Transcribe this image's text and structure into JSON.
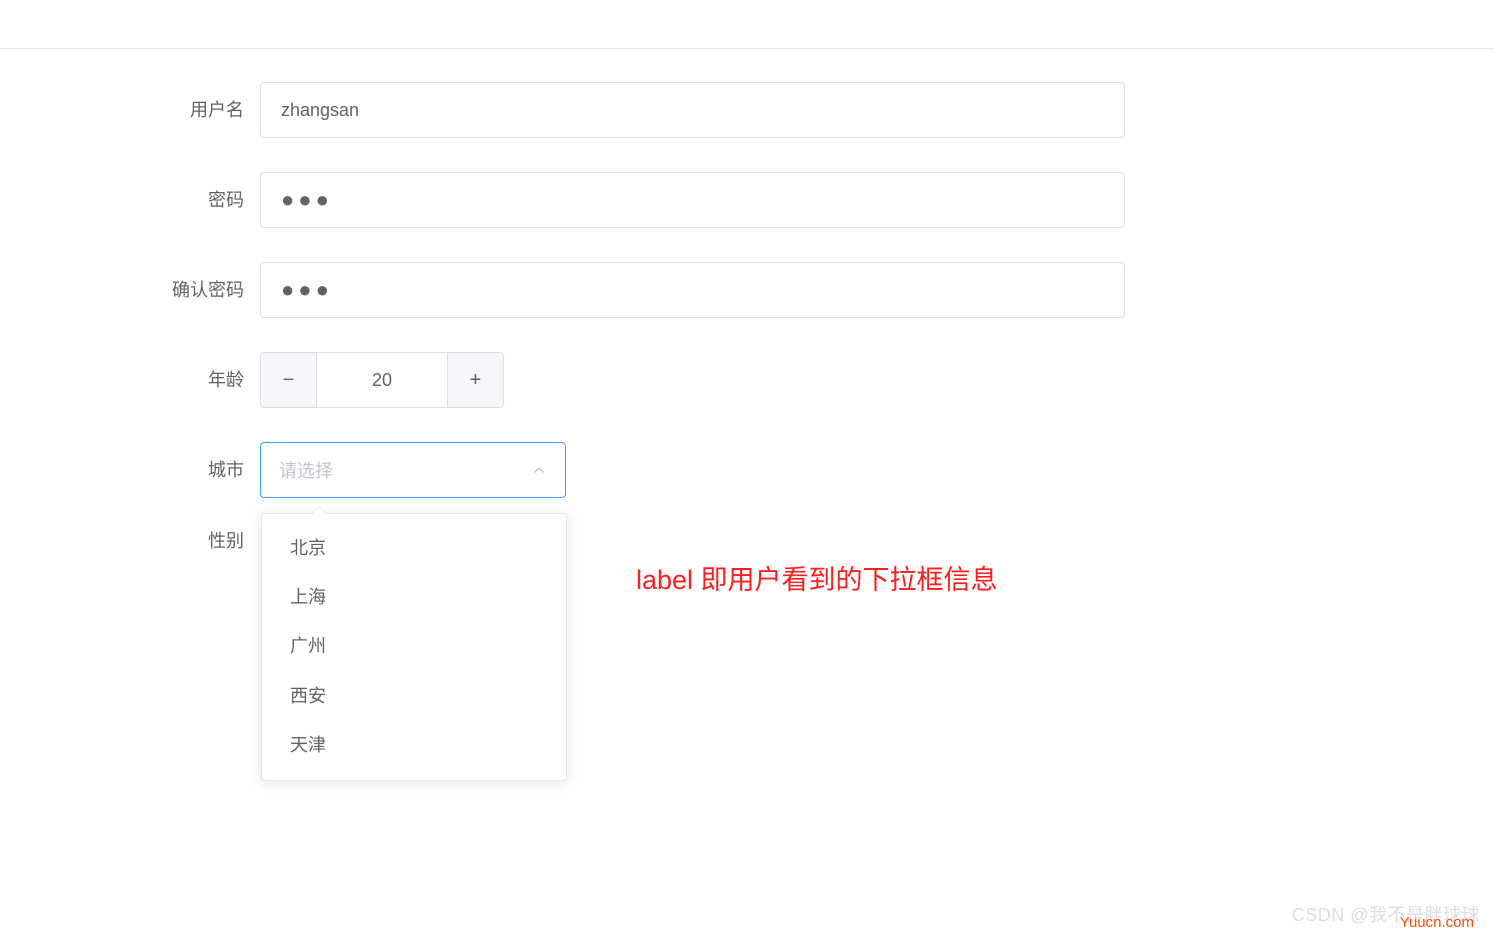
{
  "form": {
    "fields": {
      "username": {
        "label": "用户名",
        "value": "zhangsan"
      },
      "password": {
        "label": "密码",
        "value_masked": "●●●"
      },
      "confirm_password": {
        "label": "确认密码",
        "value_masked": "●●●"
      },
      "age": {
        "label": "年龄",
        "value": "20",
        "decrease_icon": "−",
        "increase_icon": "+"
      },
      "city": {
        "label": "城市",
        "placeholder": "请选择",
        "options": [
          "北京",
          "上海",
          "广州",
          "西安",
          "天津"
        ]
      },
      "gender": {
        "label": "性别"
      }
    }
  },
  "annotation_text": "label 即用户看到的下拉框信息",
  "watermarks": {
    "site": "Yuucn.com",
    "author": "CSDN @我不是胖球球"
  },
  "colors": {
    "border_default": "#dcdfe6",
    "border_active": "#409eff",
    "text": "#606266",
    "placeholder": "#c0c4cc",
    "annotation": "#ff1e1e"
  }
}
